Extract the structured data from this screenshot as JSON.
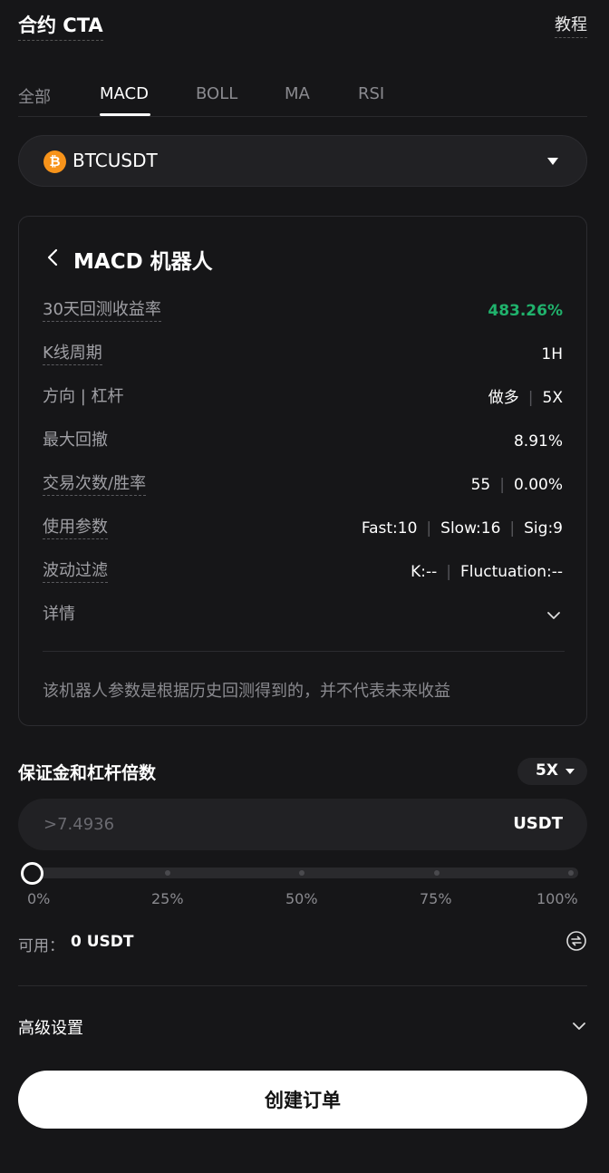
{
  "header": {
    "title": "合约 CTA",
    "tutorial": "教程"
  },
  "tabs": [
    {
      "label": "全部"
    },
    {
      "label": "MACD",
      "active": true
    },
    {
      "label": "BOLL"
    },
    {
      "label": "MA"
    },
    {
      "label": "RSI"
    }
  ],
  "pair": {
    "symbol": "BTCUSDT",
    "coin_glyph": "₿",
    "icon": "bitcoin-icon",
    "accent": "#f7931a"
  },
  "card": {
    "title": "MACD 机器人",
    "rows": {
      "return_label": "30天回测收益率",
      "return_value": "483.26%",
      "kline_label": "K线周期",
      "kline_value": "1H",
      "direction_label": "方向 | 杠杆",
      "direction_value": "做多",
      "leverage_value": "5X",
      "drawdown_label": "最大回撤",
      "drawdown_value": "8.91%",
      "trades_label": "交易次数/胜率",
      "trades_value": "55",
      "winrate_value": "0.00%",
      "params_label": "使用参数",
      "fast": "Fast:10",
      "slow": "Slow:16",
      "sig": "Sig:9",
      "filter_label": "波动过滤",
      "filter_k": "K:--",
      "filter_fluct": "Fluctuation:--",
      "details_label": "详情"
    },
    "disclaimer": "该机器人参数是根据历史回测得到的，并不代表未来收益"
  },
  "margin": {
    "label": "保证金和杠杆倍数",
    "leverage": "5X",
    "placeholder": ">7.4936",
    "unit": "USDT",
    "slider_value": 0,
    "ticks": [
      "0%",
      "25%",
      "50%",
      "75%",
      "100%"
    ]
  },
  "available": {
    "label": "可用：",
    "value": "0 USDT"
  },
  "advanced": {
    "label": "高级设置"
  },
  "create_button": "创建订单",
  "colors": {
    "background": "#161618",
    "positive": "#20b26c",
    "card_border": "#2c2c30"
  }
}
